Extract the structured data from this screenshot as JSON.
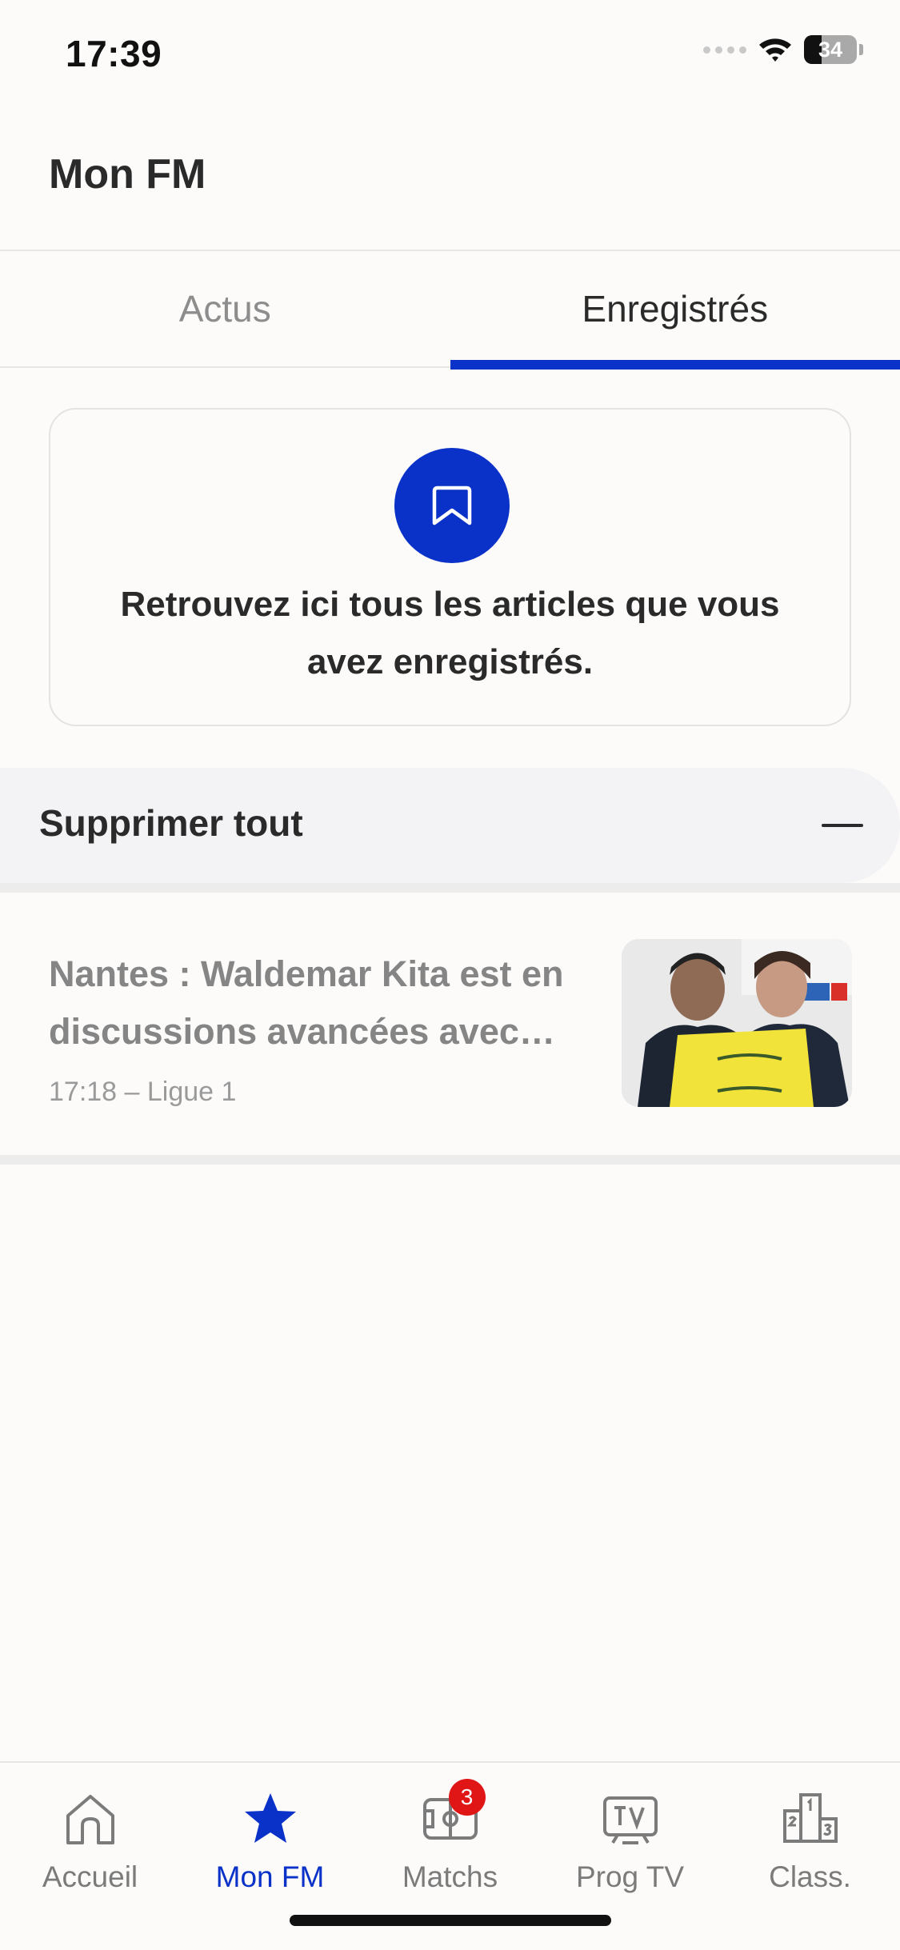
{
  "status_bar": {
    "time": "17:39",
    "battery": "34",
    "battery_level_pct": 34
  },
  "header": {
    "title": "Mon FM"
  },
  "tabs": [
    {
      "label": "Actus",
      "active": false
    },
    {
      "label": "Enregistrés",
      "active": true
    }
  ],
  "empty_state": {
    "icon": "bookmark-icon",
    "message": "Retrouvez ici tous les articles que vous avez enregistrés."
  },
  "delete_all": {
    "label": "Supprimer tout",
    "icon": "minus-icon"
  },
  "articles": [
    {
      "title": "Nantes : Waldemar Kita est en discussions avancées avec…",
      "meta": "17:18 – Ligue 1"
    }
  ],
  "bottom_nav": [
    {
      "label": "Accueil",
      "icon": "home-icon",
      "active": false
    },
    {
      "label": "Mon FM",
      "icon": "star-icon",
      "active": true
    },
    {
      "label": "Matchs",
      "icon": "pitch-icon",
      "active": false,
      "badge": "3"
    },
    {
      "label": "Prog TV",
      "icon": "tv-icon",
      "active": false
    },
    {
      "label": "Class.",
      "icon": "podium-icon",
      "active": false
    }
  ],
  "colors": {
    "accent": "#0a32c8",
    "badge": "#e01616",
    "background": "#fcfbfa"
  }
}
